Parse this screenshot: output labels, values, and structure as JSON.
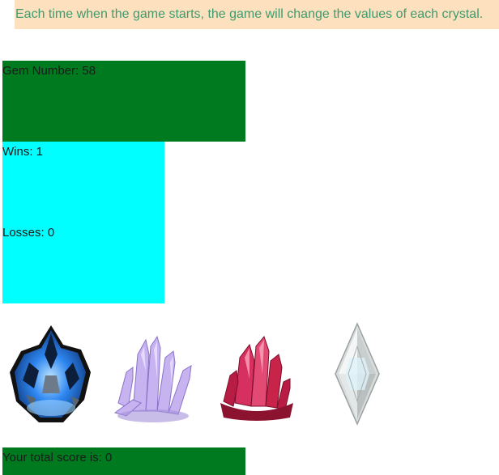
{
  "banner": {
    "text": "Each time when the game starts, the game will change the values of each crystal."
  },
  "game": {
    "gem_number_label": "Gem Number: 58",
    "wins_label": "Wins: 1",
    "losses_label": "Losses: 0",
    "total_score_label": "Your total score is: 0"
  },
  "crystals": [
    {
      "name": "blue-crystal-icon",
      "color": "#1f6fd6"
    },
    {
      "name": "purple-crystal-icon",
      "color": "#b59ae8"
    },
    {
      "name": "red-crystal-icon",
      "color": "#c8244a"
    },
    {
      "name": "white-crystal-icon",
      "color": "#e8eaea"
    }
  ],
  "colors": {
    "banner_bg": "#fde0be",
    "banner_text": "#3f9b6f",
    "gem_box": "#007a1f",
    "score_panel": "#00ffff"
  }
}
